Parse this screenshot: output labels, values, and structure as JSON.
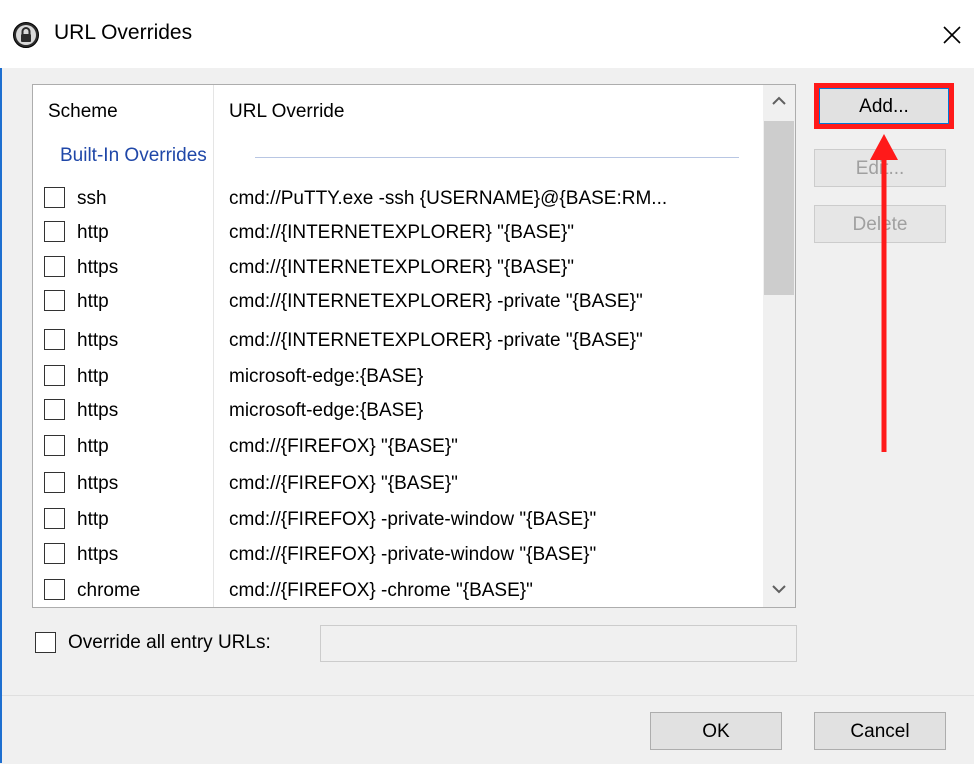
{
  "window": {
    "title": "URL Overrides",
    "app_icon": "lock-icon",
    "close_icon": "close-icon"
  },
  "list": {
    "columns": [
      "Scheme",
      "URL Override"
    ],
    "group_label": "Built-In Overrides",
    "rows": [
      {
        "checked": false,
        "scheme": "ssh",
        "url": "cmd://PuTTY.exe -ssh {USERNAME}@{BASE:RM..."
      },
      {
        "checked": false,
        "scheme": "http",
        "url": "cmd://{INTERNETEXPLORER} \"{BASE}\""
      },
      {
        "checked": false,
        "scheme": "https",
        "url": "cmd://{INTERNETEXPLORER} \"{BASE}\""
      },
      {
        "checked": false,
        "scheme": "http",
        "url": "cmd://{INTERNETEXPLORER} -private \"{BASE}\""
      },
      {
        "checked": false,
        "scheme": "https",
        "url": "cmd://{INTERNETEXPLORER} -private \"{BASE}\""
      },
      {
        "checked": false,
        "scheme": "http",
        "url": "microsoft-edge:{BASE}"
      },
      {
        "checked": false,
        "scheme": "https",
        "url": "microsoft-edge:{BASE}"
      },
      {
        "checked": false,
        "scheme": "http",
        "url": "cmd://{FIREFOX} \"{BASE}\""
      },
      {
        "checked": false,
        "scheme": "https",
        "url": "cmd://{FIREFOX} \"{BASE}\""
      },
      {
        "checked": false,
        "scheme": "http",
        "url": "cmd://{FIREFOX} -private-window \"{BASE}\""
      },
      {
        "checked": false,
        "scheme": "https",
        "url": "cmd://{FIREFOX} -private-window \"{BASE}\""
      },
      {
        "checked": false,
        "scheme": "chrome",
        "url": "cmd://{FIREFOX} -chrome \"{BASE}\""
      }
    ]
  },
  "buttons": {
    "add": "Add...",
    "edit": "Edit...",
    "delete": "Delete",
    "ok": "OK",
    "cancel": "Cancel"
  },
  "override_all": {
    "label": "Override all entry URLs:",
    "checked": false,
    "value": ""
  },
  "annotation": {
    "highlight_color": "#ff1a1a"
  }
}
